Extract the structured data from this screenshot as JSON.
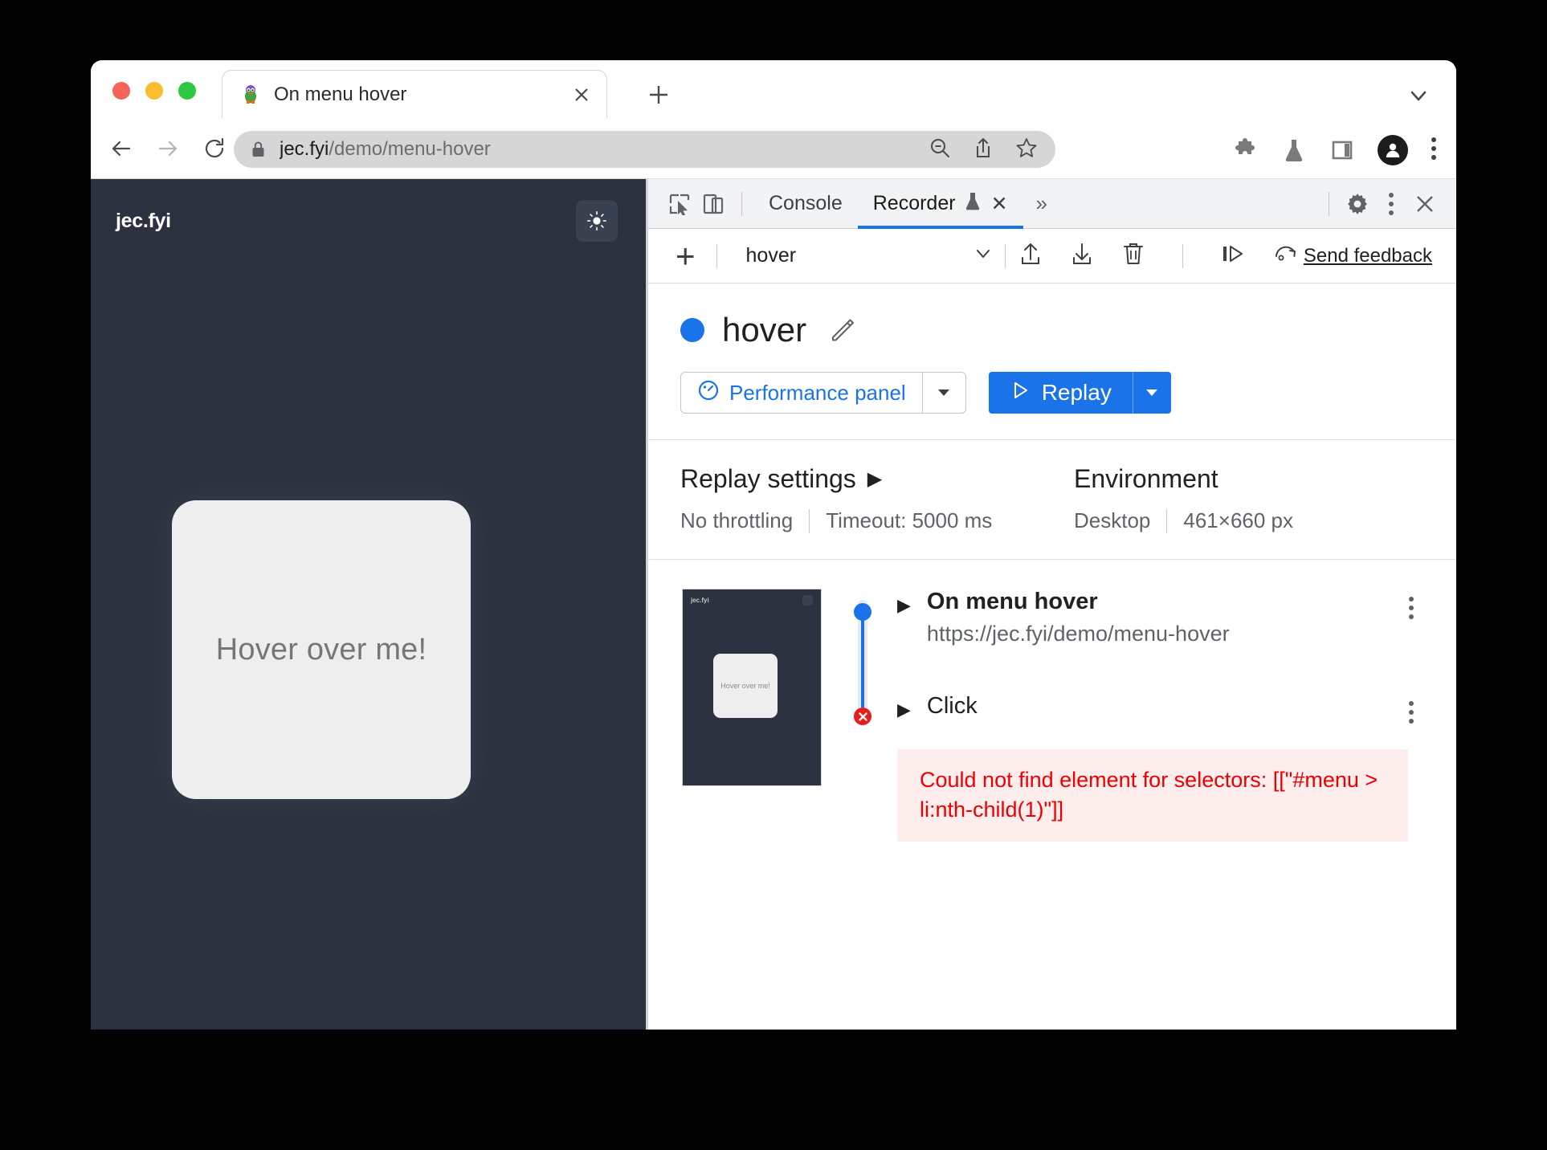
{
  "browser": {
    "tab": {
      "title": "On menu hover",
      "favicon": "penguin-favicon",
      "close_label": "✕"
    },
    "new_tab_label": "+",
    "window_chevron": "chevron-down-icon",
    "nav": {
      "back": "back-arrow-icon",
      "forward": "forward-arrow-icon",
      "reload": "reload-icon"
    },
    "omnibox": {
      "lock": "lock-icon",
      "host": "jec.fyi",
      "path": "/demo/menu-hover",
      "actions": [
        "zoom-out-icon",
        "share-icon",
        "bookmark-star-icon"
      ]
    },
    "toolbar_icons": [
      "extensions-puzzle-icon",
      "labs-flask-icon",
      "side-panel-icon",
      "profile-avatar",
      "browser-menu-kebab"
    ]
  },
  "page": {
    "logo": "jec.fyi",
    "theme_toggle": "sun-icon",
    "card_label": "Hover over me!"
  },
  "devtools": {
    "left_icons": [
      "inspect-element-icon",
      "device-toolbar-icon"
    ],
    "tabs": [
      {
        "label": "Console",
        "active": false
      },
      {
        "label": "Recorder",
        "active": true,
        "badge": "experimental-flask-icon",
        "close": "✕"
      }
    ],
    "overflow": "»",
    "right_icons": [
      "settings-gear-icon",
      "devtools-menu-kebab",
      "close-devtools-icon"
    ]
  },
  "recorder_toolbar": {
    "add_label": "+",
    "selected_recording": "hover",
    "caret": "chevron-down-icon",
    "icons": [
      "export-icon",
      "import-icon",
      "delete-icon",
      "step-over-icon",
      "replay-again-icon"
    ],
    "feedback_label": "Send feedback"
  },
  "recording": {
    "status_color": "#1a73e8",
    "name": "hover",
    "edit_icon": "pencil-icon",
    "performance_button": {
      "label": "Performance panel",
      "icon": "performance-gauge-icon",
      "caret": "chevron-down-icon"
    },
    "replay_button": {
      "label": "Replay",
      "icon": "play-triangle-icon",
      "caret": "chevron-down-icon"
    }
  },
  "settings": {
    "replay": {
      "heading": "Replay settings",
      "expander": "▶",
      "throttling": "No throttling",
      "timeout": "Timeout: 5000 ms"
    },
    "environment": {
      "heading": "Environment",
      "device": "Desktop",
      "viewport": "461×660 px"
    }
  },
  "steps": {
    "thumbnail": {
      "logo": "jec.fyi",
      "card_label": "Hover over me!"
    },
    "items": [
      {
        "title": "On menu hover",
        "url": "https://jec.fyi/demo/menu-hover",
        "status": "start",
        "caret": "▶",
        "menu": "step-menu-kebab"
      },
      {
        "title": "Click",
        "status": "error",
        "caret": "▶",
        "menu": "step-menu-kebab",
        "error": "Could not find element for selectors: [[\"#menu > li:nth-child(1)\"]]"
      }
    ]
  },
  "colors": {
    "accent_blue": "#1a73e8",
    "error_red": "#ee0000",
    "page_dark": "#2b313e"
  }
}
